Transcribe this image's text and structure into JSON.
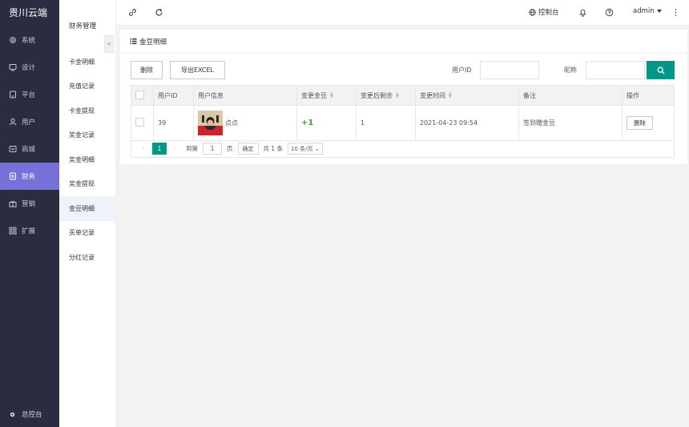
{
  "brand": "贵川云端",
  "sidebar": {
    "items": [
      {
        "label": "系统",
        "icon": "gear-icon"
      },
      {
        "label": "设计",
        "icon": "monitor-icon"
      },
      {
        "label": "平台",
        "icon": "tablet-icon"
      },
      {
        "label": "用户",
        "icon": "user-icon"
      },
      {
        "label": "商城",
        "icon": "store-icon"
      },
      {
        "label": "财务",
        "icon": "finance-icon",
        "active": true
      },
      {
        "label": "营销",
        "icon": "gift-icon"
      },
      {
        "label": "扩展",
        "icon": "grid-icon"
      }
    ],
    "console_label": "总控台"
  },
  "subnav": {
    "title": "财务管理",
    "items": [
      "卡金明细",
      "充值记录",
      "卡金提现",
      "奖金记录",
      "奖金明细",
      "奖金提现",
      "金豆明细",
      "买单记录",
      "分红记录"
    ],
    "active_index": 6
  },
  "topbar": {
    "control_label": "控制台",
    "user": "admin"
  },
  "page": {
    "title": "金豆明细",
    "delete_btn": "删除",
    "export_btn": "导出EXCEL",
    "user_id_label": "用户ID",
    "nickname_label": "昵称"
  },
  "table": {
    "headers": [
      "用户ID",
      "用户信息",
      "变更金豆",
      "变更后剩余",
      "变更时间",
      "备注",
      "操作"
    ],
    "rows": [
      {
        "user_id": "39",
        "user_name": "点点",
        "change": "+1",
        "remaining": "1",
        "time": "2021-04-23 09:54",
        "note": "签到赠金豆",
        "action": "删除"
      }
    ]
  },
  "pagination": {
    "current": "1",
    "goto_label": "到第",
    "goto_value": "1",
    "page_unit": "页",
    "confirm": "确定",
    "total": "共 1 条",
    "per_page": "10 条/页"
  },
  "colors": {
    "sidebar_bg": "#2b2c40",
    "active": "#7670d8",
    "primary": "#009688",
    "positive": "#2eab2e"
  }
}
